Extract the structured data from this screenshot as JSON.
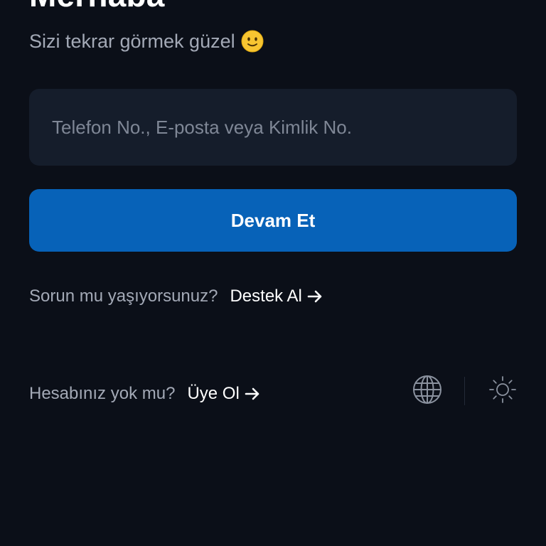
{
  "header": {
    "title": "Merhaba",
    "subtitle": "Sizi tekrar görmek güzel",
    "subtitle_emoji": "slightly-smiling-face-emoji"
  },
  "login": {
    "input_value": "",
    "input_placeholder": "Telefon No., E-posta veya Kimlik No.",
    "continue_label": "Devam Et"
  },
  "help": {
    "question": "Sorun mu yaşıyorsunuz?",
    "link_label": "Destek Al"
  },
  "signup": {
    "question": "Hesabınız yok mu?",
    "link_label": "Üye Ol"
  },
  "icons": {
    "language": "globe-icon",
    "theme": "sun-icon",
    "link_arrow": "arrow-right-icon"
  },
  "colors": {
    "background": "#0b0f18",
    "input_background": "#151d2b",
    "primary_button": "#0762b8",
    "muted_text": "#a3a9b6",
    "placeholder_text": "#7f8796",
    "text": "#ffffff",
    "icon": "#8a919e"
  }
}
